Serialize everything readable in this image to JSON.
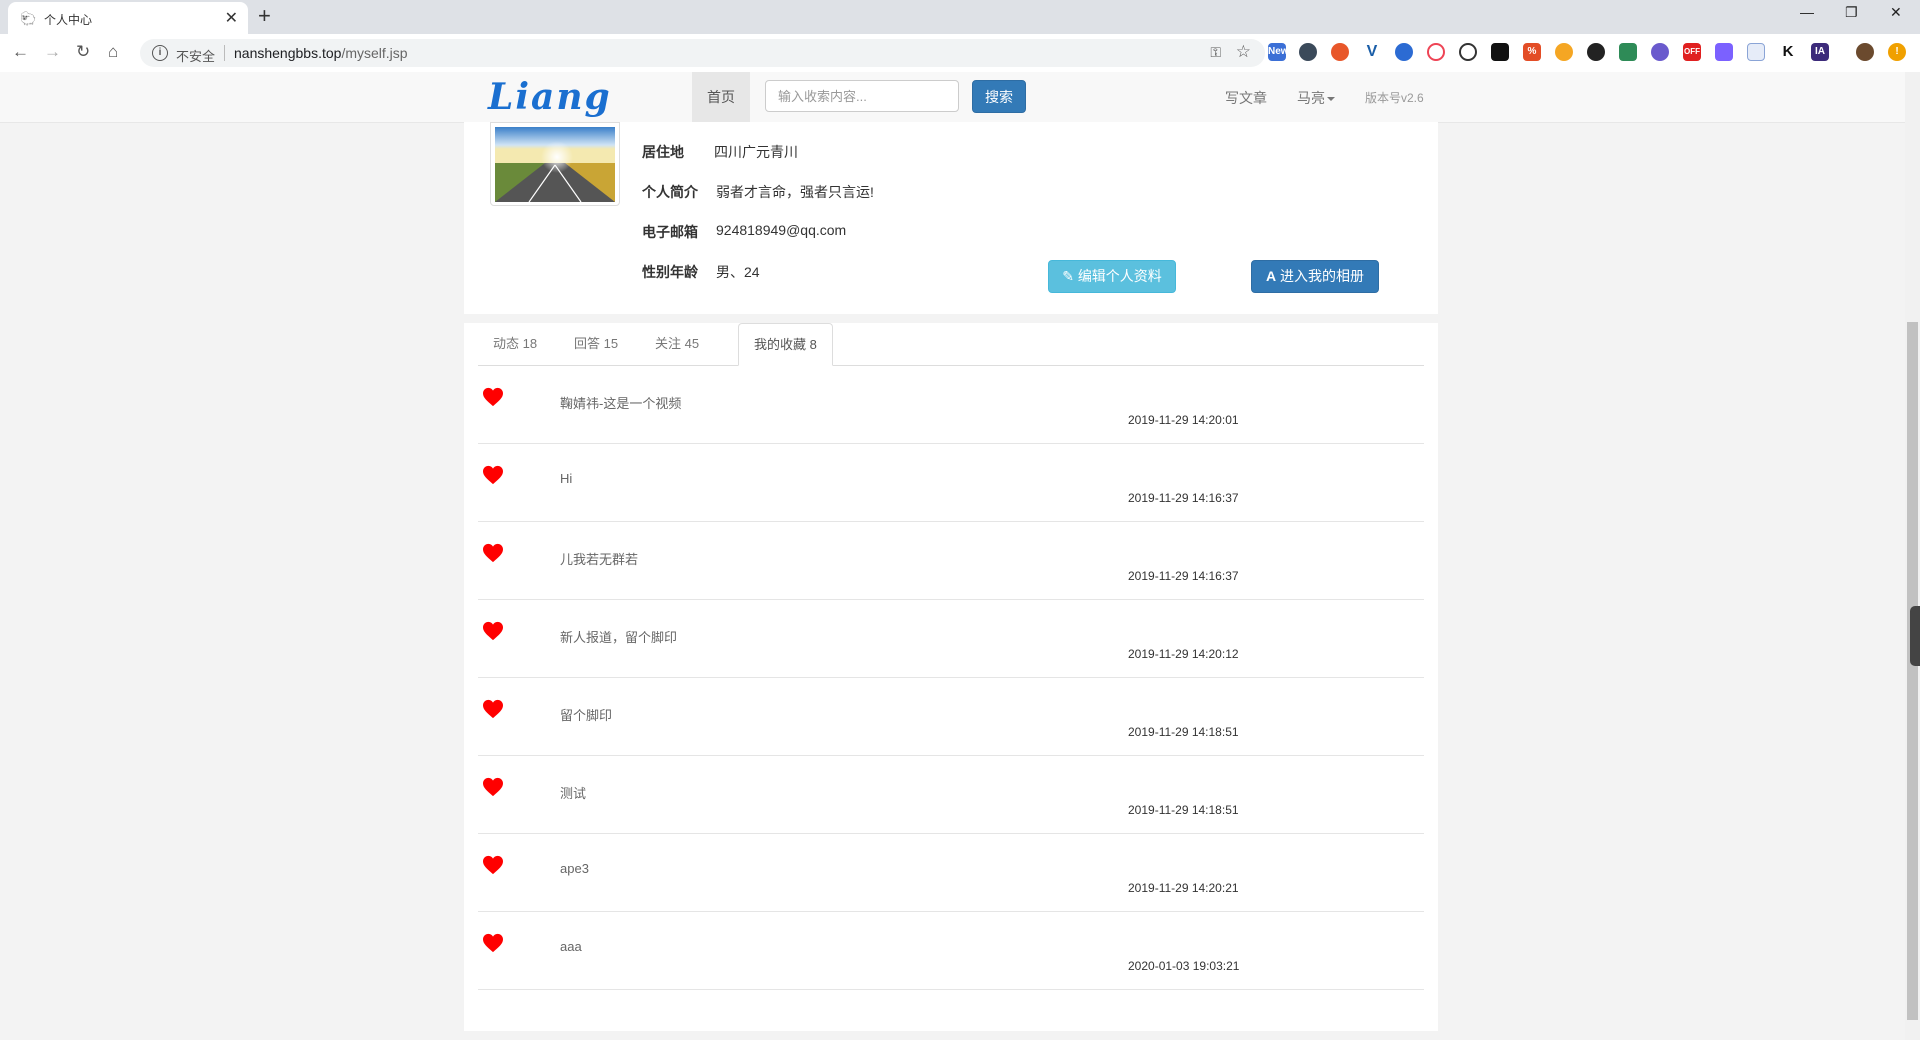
{
  "browser": {
    "tab_title": "个人中心",
    "new_tab": "+",
    "insecure_label": "不安全",
    "url_host": "nanshengbbs.top",
    "url_path": "/myself.jsp",
    "extension_badges": [
      "New",
      "OFF"
    ]
  },
  "header": {
    "logo": "Liang",
    "home": "首页",
    "search_placeholder": "输入收索内容...",
    "search_button": "搜索",
    "write_article": "写文章",
    "user_name": "马亮",
    "version": "版本号v2.6"
  },
  "profile": {
    "fields": [
      {
        "label": "居住地",
        "value": "四川广元青川"
      },
      {
        "label": "个人简介",
        "value": "弱者才言命，强者只言运!"
      },
      {
        "label": "电子邮箱",
        "value": "924818949@qq.com"
      },
      {
        "label": "性别年龄",
        "value": "男、24"
      }
    ],
    "edit_button": "编辑个人资料",
    "album_button": "进入我的相册"
  },
  "tabs": [
    {
      "label": "动态 18",
      "active": false
    },
    {
      "label": "回答 15",
      "active": false
    },
    {
      "label": "关注 45",
      "active": false
    },
    {
      "label": "我的收藏 8",
      "active": true
    }
  ],
  "favorites": [
    {
      "title": "鞠婧祎-这是一个视频",
      "time": "2019-11-29 14:20:01"
    },
    {
      "title": "Hi",
      "time": "2019-11-29 14:16:37"
    },
    {
      "title": "儿我若无群若",
      "time": "2019-11-29 14:16:37"
    },
    {
      "title": "新人报道，留个脚印",
      "time": "2019-11-29 14:20:12"
    },
    {
      "title": "留个脚印",
      "time": "2019-11-29 14:18:51"
    },
    {
      "title": "测试",
      "time": "2019-11-29 14:18:51"
    },
    {
      "title": "ape3",
      "time": "2019-11-29 14:20:21"
    },
    {
      "title": "aaa",
      "time": "2020-01-03 19:03:21"
    }
  ],
  "colors": {
    "accent": "#337ab7",
    "info": "#5bc0de",
    "heart": "#ff0000",
    "logo": "#1a6fd0"
  }
}
